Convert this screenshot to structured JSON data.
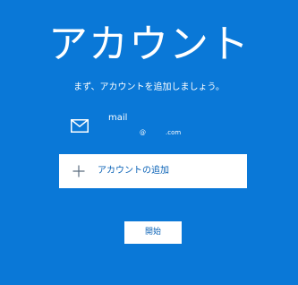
{
  "colors": {
    "background": "#0a78d7",
    "text": "#ffffff",
    "button_background": "#ffffff",
    "button_text": "#0a62b6"
  },
  "header": {
    "title": "アカウント",
    "subtitle": "まず、アカウントを追加しましょう。"
  },
  "account": {
    "icon": "mail-icon",
    "name": "mail",
    "at": "@",
    "domain": ".com"
  },
  "add_account": {
    "icon": "plus-icon",
    "label": "アカウントの追加"
  },
  "start_button": {
    "label": "開始"
  }
}
